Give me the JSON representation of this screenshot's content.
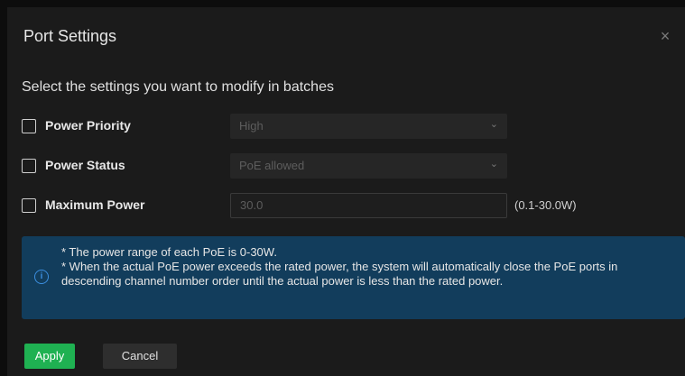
{
  "dialog": {
    "title": "Port Settings",
    "close_icon": "×"
  },
  "section_title": "Select the settings you want to modify in batches",
  "rows": [
    {
      "label": "Power Priority",
      "value": "High"
    },
    {
      "label": "Power Status",
      "value": "PoE allowed"
    },
    {
      "label": "Maximum Power",
      "value": "30.0",
      "range": "(0.1-30.0W)"
    }
  ],
  "info": {
    "icon": "i",
    "line1": "* The power range of each PoE is 0-30W.",
    "line2": "* When the actual PoE power exceeds the rated power, the system will automatically close the PoE ports in descending channel number order until the actual power is less than the rated power."
  },
  "buttons": {
    "apply": "Apply",
    "cancel": "Cancel"
  },
  "colors": {
    "dialog_bg": "#1b1b1b",
    "info_bg": "#123d5c",
    "apply_bg": "#1fb152"
  }
}
